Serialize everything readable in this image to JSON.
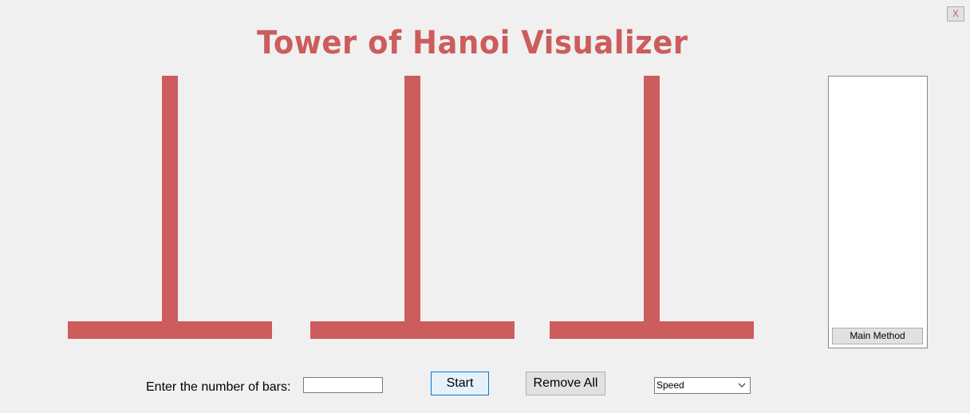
{
  "window": {
    "close_label": "X"
  },
  "title": {
    "text": "Tower of Hanoi Visualizer"
  },
  "colors": {
    "accent": "#cd5c5c",
    "background": "#f0f0f0"
  },
  "towers": [
    {
      "name": "tower-1"
    },
    {
      "name": "tower-2"
    },
    {
      "name": "tower-3"
    }
  ],
  "side_panel": {
    "main_method_label": "Main Method"
  },
  "controls": {
    "bars_label": "Enter the number of bars:",
    "bars_value": "",
    "start_label": "Start",
    "remove_all_label": "Remove All",
    "speed_selected": "Speed"
  },
  "icons": {
    "dropdown": "chevron-down-icon"
  }
}
